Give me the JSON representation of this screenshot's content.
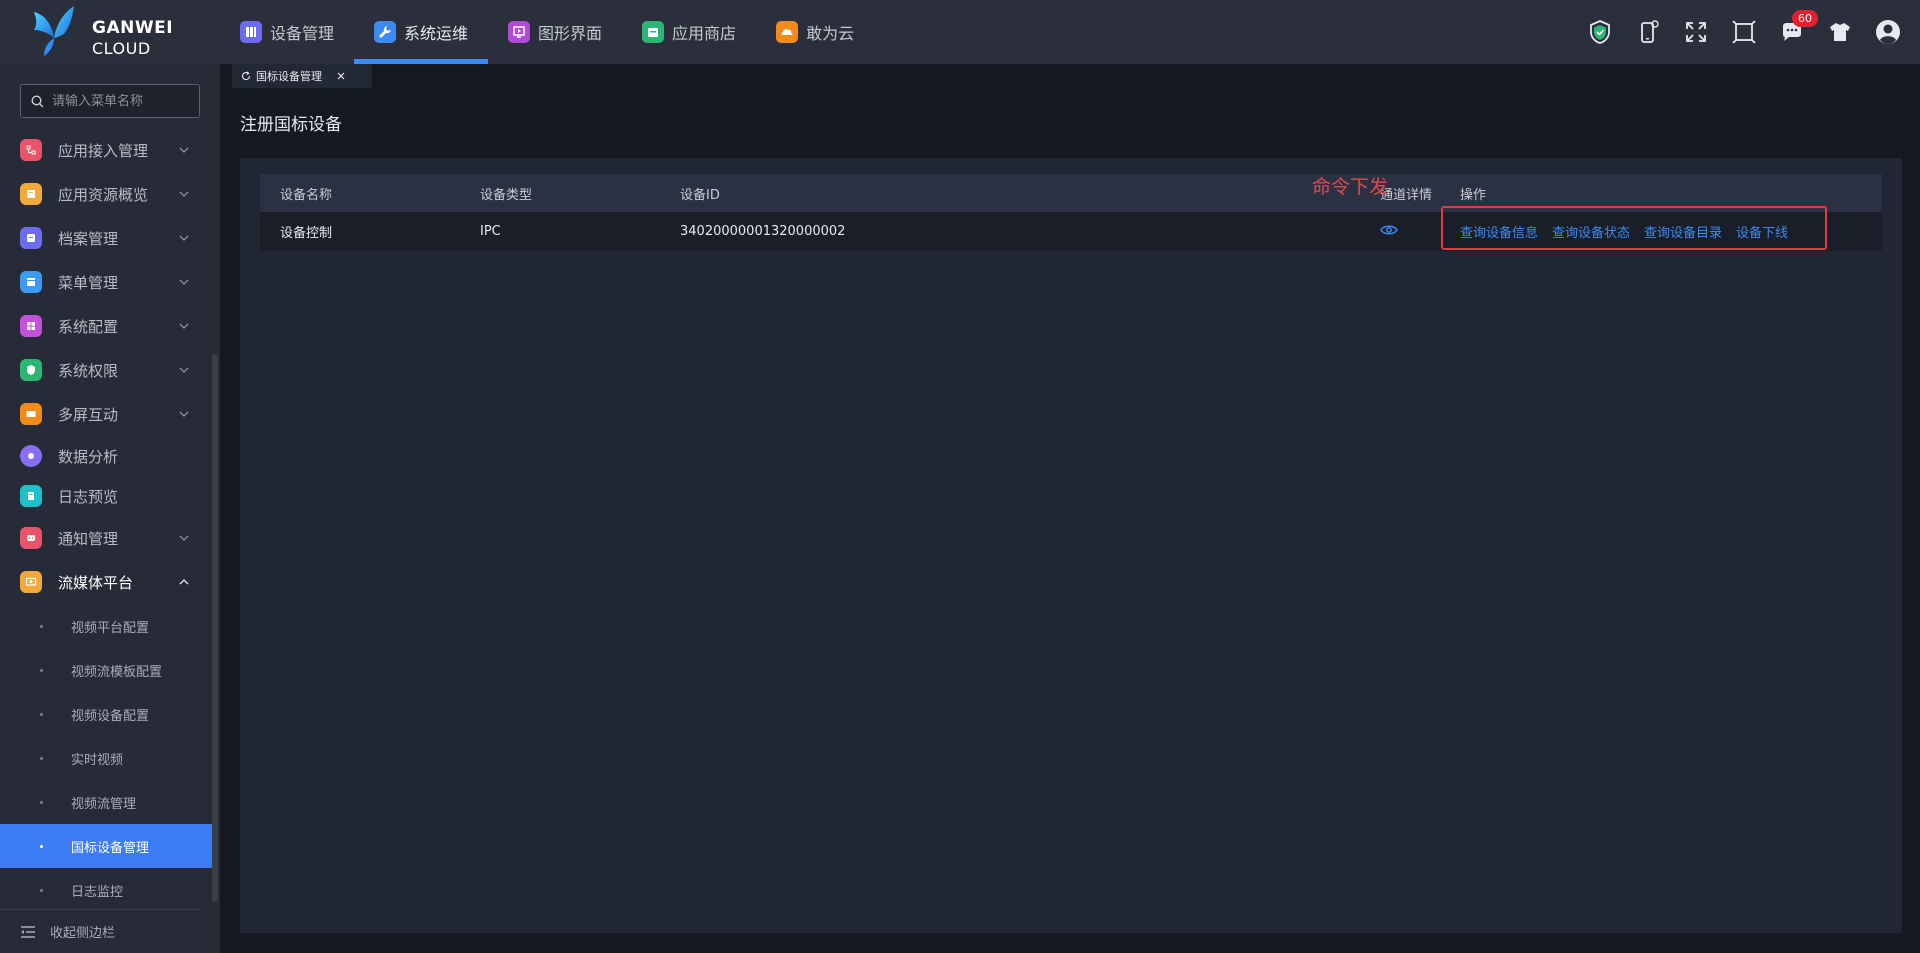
{
  "brand": {
    "name": "GANWEI",
    "sub": "CLOUD"
  },
  "nav": [
    {
      "label": "设备管理",
      "color": "#6b6cf0"
    },
    {
      "label": "系统运维",
      "color": "#3d8bf2"
    },
    {
      "label": "图形界面",
      "color": "#b04ad9"
    },
    {
      "label": "应用商店",
      "color": "#2bb673"
    },
    {
      "label": "敢为云",
      "color": "#f28a1c"
    }
  ],
  "topbar": {
    "notification_count": "60"
  },
  "sidebar": {
    "search_placeholder": "请输入菜单名称",
    "items": [
      {
        "label": "应用接入管理",
        "color": "#e9546b"
      },
      {
        "label": "应用资源概览",
        "color": "#f2a93b"
      },
      {
        "label": "档案管理",
        "color": "#6b6cf0"
      },
      {
        "label": "菜单管理",
        "color": "#3d9bf2"
      },
      {
        "label": "系统配置",
        "color": "#c452d9"
      },
      {
        "label": "系统权限",
        "color": "#2bb673"
      },
      {
        "label": "多屏互动",
        "color": "#f28a1c"
      },
      {
        "label": "数据分析",
        "color": "#8a6cf0"
      },
      {
        "label": "日志预览",
        "color": "#1fc0c9"
      },
      {
        "label": "通知管理",
        "color": "#e9546b"
      },
      {
        "label": "流媒体平台",
        "color": "#f2a93b"
      }
    ],
    "sub_items": [
      "视频平台配置",
      "视频流模板配置",
      "视频设备配置",
      "实时视频",
      "视频流管理",
      "国标设备管理",
      "日志监控"
    ],
    "collapse_label": "收起侧边栏"
  },
  "tab": {
    "label": "国标设备管理"
  },
  "page": {
    "title": "注册国标设备"
  },
  "table": {
    "headers": [
      "设备名称",
      "设备类型",
      "设备ID",
      "通道详情",
      "操作"
    ],
    "rows": [
      {
        "name": "设备控制",
        "type": "IPC",
        "id": "34020000001320000002"
      }
    ],
    "actions": [
      "查询设备信息",
      "查询设备状态",
      "查询设备目录",
      "设备下线"
    ]
  },
  "annotation": "命令下发"
}
